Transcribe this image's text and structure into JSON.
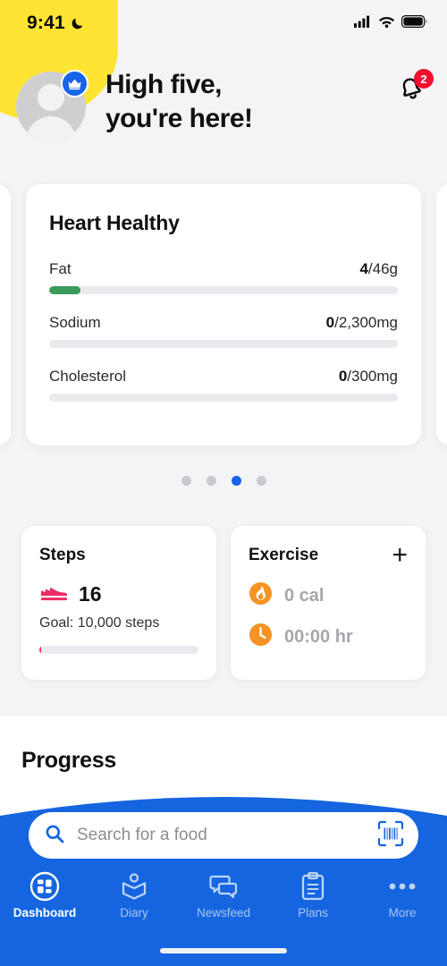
{
  "status_bar": {
    "time": "9:41",
    "moon_icon": "moon-icon",
    "signal_icon": "cellular-signal-icon",
    "wifi_icon": "wifi-icon",
    "battery_icon": "battery-full-icon"
  },
  "header": {
    "avatar_icon": "user-avatar",
    "crown_icon": "crown-badge-icon",
    "greeting_line1": "High five,",
    "greeting_line2": "you're here!",
    "bell_icon": "notification-bell-icon",
    "bell_badge_count": "2",
    "blob_color": "#ffe433",
    "badge_color": "#f3102e",
    "crown_bg_color": "#1664e8"
  },
  "carousel": {
    "card": {
      "title": "Heart Healthy",
      "nutrients": [
        {
          "name": "Fat",
          "current": "4",
          "target": "/46g",
          "percent": 9,
          "fill_color": "#3a9b5c"
        },
        {
          "name": "Sodium",
          "current": "0",
          "target": "/2,300mg",
          "percent": 0,
          "fill_color": "#3a9b5c"
        },
        {
          "name": "Cholesterol",
          "current": "0",
          "target": "/300mg",
          "percent": 0,
          "fill_color": "#3a9b5c"
        }
      ]
    },
    "dots_total": 4,
    "dots_active_index": 2,
    "dot_active_color": "#1664e8",
    "dot_inactive_color": "#c9c9cf"
  },
  "stats": {
    "steps": {
      "title": "Steps",
      "shoe_icon": "running-shoe-icon",
      "count": "16",
      "goal_text": "Goal: 10,000 steps",
      "percent": 0.16,
      "fill_color": "#ef2b63"
    },
    "exercise": {
      "title": "Exercise",
      "add_icon": "plus-icon",
      "add_label": "+",
      "calories_icon": "flame-icon",
      "calories_value": "0 cal",
      "duration_icon": "clock-icon",
      "duration_value": "00:00 hr",
      "icon_color": "#f59324"
    }
  },
  "progress": {
    "title": "Progress"
  },
  "bottom": {
    "panel_color": "#1565e0",
    "search": {
      "search_icon": "search-icon",
      "placeholder": "Search for a food",
      "value": "",
      "barcode_icon": "barcode-scanner-icon"
    },
    "tabs": [
      {
        "label": "Dashboard",
        "icon": "dashboard-grid-icon",
        "active": true
      },
      {
        "label": "Diary",
        "icon": "diary-book-icon",
        "active": false
      },
      {
        "label": "Newsfeed",
        "icon": "newsfeed-chat-icon",
        "active": false
      },
      {
        "label": "Plans",
        "icon": "plans-clipboard-icon",
        "active": false
      },
      {
        "label": "More",
        "icon": "more-dots-icon",
        "active": false
      }
    ],
    "home_indicator": "home-indicator"
  }
}
